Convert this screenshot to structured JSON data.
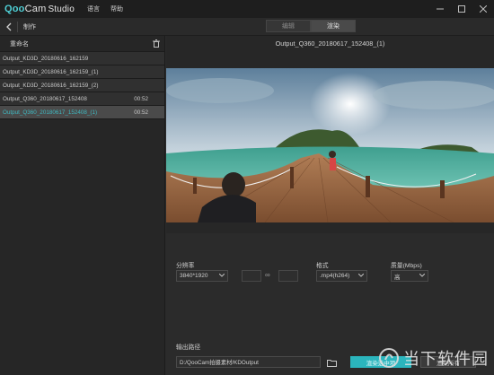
{
  "app": {
    "brand_prefix": "Qoo",
    "brand_mid": "Cam",
    "brand_suffix": "Studio"
  },
  "menu": {
    "language": "语言",
    "help": "帮助"
  },
  "toolbar": {
    "crumb": "制作",
    "tabs": [
      "编辑",
      "渲染"
    ],
    "active_tab": 1
  },
  "sidebar": {
    "title": "重命名",
    "items": [
      {
        "name": "Output_KD3D_20180616_162159",
        "duration": ""
      },
      {
        "name": "Output_KD3D_20180616_162159_(1)",
        "duration": ""
      },
      {
        "name": "Output_KD3D_20180616_162159_(2)",
        "duration": ""
      },
      {
        "name": "Output_Q360_20180617_152408",
        "duration": "00:52"
      },
      {
        "name": "Output_Q360_20180617_152408_(1)",
        "duration": "00:52",
        "selected": true
      }
    ]
  },
  "main": {
    "filename": "Output_Q360_20180617_152408_(1)"
  },
  "settings": {
    "resolution_label": "分辨率",
    "resolution_value": "3840*1920",
    "format_label": "格式",
    "format_value": ".mp4(h264)",
    "quality_label": "质量(Mbps)",
    "quality_value": "高",
    "output_label": "输出路径",
    "output_path": "D:/QooCam拍摄素材/KDOutput",
    "render_selected": "渲染选中项",
    "render_all": "渲染所有"
  },
  "watermark": {
    "text": "当下软件园"
  },
  "colors": {
    "accent": "#2bb5bd",
    "selected_text": "#3fb8c0"
  }
}
